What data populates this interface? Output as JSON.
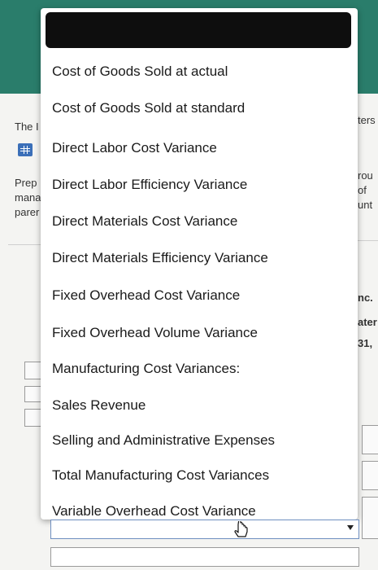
{
  "background": {
    "left_text": [
      "The I",
      "Prep",
      "mana",
      "parer"
    ],
    "right_text": [
      "ters",
      "rou",
      "of",
      "unt",
      "nc.",
      "ater",
      "31,"
    ]
  },
  "dropdown": {
    "options": [
      "Cost of Goods Sold at actual",
      "Cost of Goods Sold at standard",
      "Direct Labor Cost Variance",
      "Direct Labor Efficiency Variance",
      "Direct Materials Cost Variance",
      "Direct Materials Efficiency Variance",
      "Fixed Overhead Cost Variance",
      "Fixed Overhead Volume Variance",
      "Manufacturing Cost Variances:",
      "Sales Revenue",
      "Selling and Administrative Expenses",
      "Total Manufacturing Cost Variances",
      "Variable Overhead Cost Variance"
    ]
  },
  "icons": {
    "cursor": "hand-pointer-icon",
    "grid": "table-grid-icon",
    "arrow": "chevron-down-icon"
  },
  "colors": {
    "header_band": "#2a7d6b",
    "dropdown_header": "#0e0e0e",
    "select_border": "#6f8fc0"
  }
}
